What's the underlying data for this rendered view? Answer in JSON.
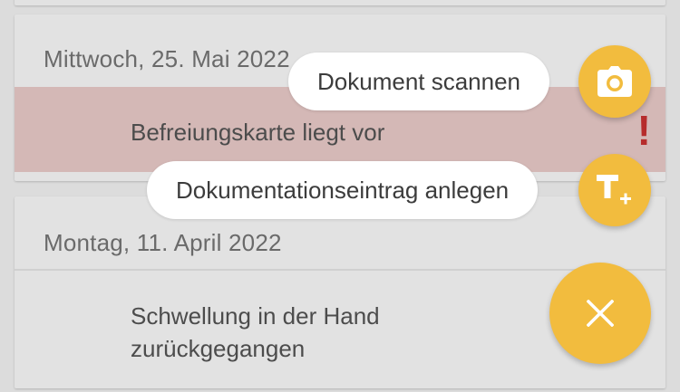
{
  "cards": [
    {
      "date": "Mittwoch, 25. Mai 2022",
      "entry": "Befreiungskarte liegt vor",
      "alert": "!"
    },
    {
      "date": "Montag, 11. April 2022",
      "entry": "Schwellung in der Hand zurückgegangen"
    }
  ],
  "speed_dial": {
    "scan_label": "Dokument scannen",
    "scan_icon": "camera-icon",
    "entry_label": "Dokumentationseintrag anlegen",
    "entry_icon": "text-add-icon",
    "close_icon": "close-icon"
  },
  "colors": {
    "accent": "#f2bc3e",
    "highlight_row": "#d4b8b6",
    "alert": "#b62c2c",
    "background": "#dcdcdc"
  }
}
